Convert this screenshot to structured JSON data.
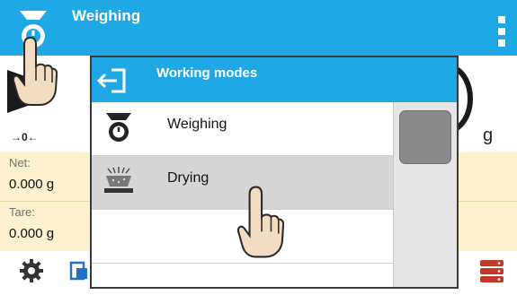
{
  "header": {
    "title": "Weighing",
    "mode_icon": "weighing-mode-icon",
    "menu_icon": "more-vertical-icon",
    "color": "#1ea9e6"
  },
  "display": {
    "zero_indicator": "→0←",
    "unit": "g",
    "net_label": "Net:",
    "net_value": "0.000 g",
    "tare_label": "Tare:",
    "tare_value": "0.000 g"
  },
  "bottom_bar": {
    "icons": [
      "gear-icon",
      "printer-icon",
      "database-icon"
    ]
  },
  "modal": {
    "title": "Working modes",
    "back_icon": "back-arrow-icon",
    "items": [
      {
        "label": "Weighing",
        "icon": "weighing-mode-icon",
        "selected": false
      },
      {
        "label": "Drying",
        "icon": "drying-mode-icon",
        "selected": true
      }
    ]
  }
}
